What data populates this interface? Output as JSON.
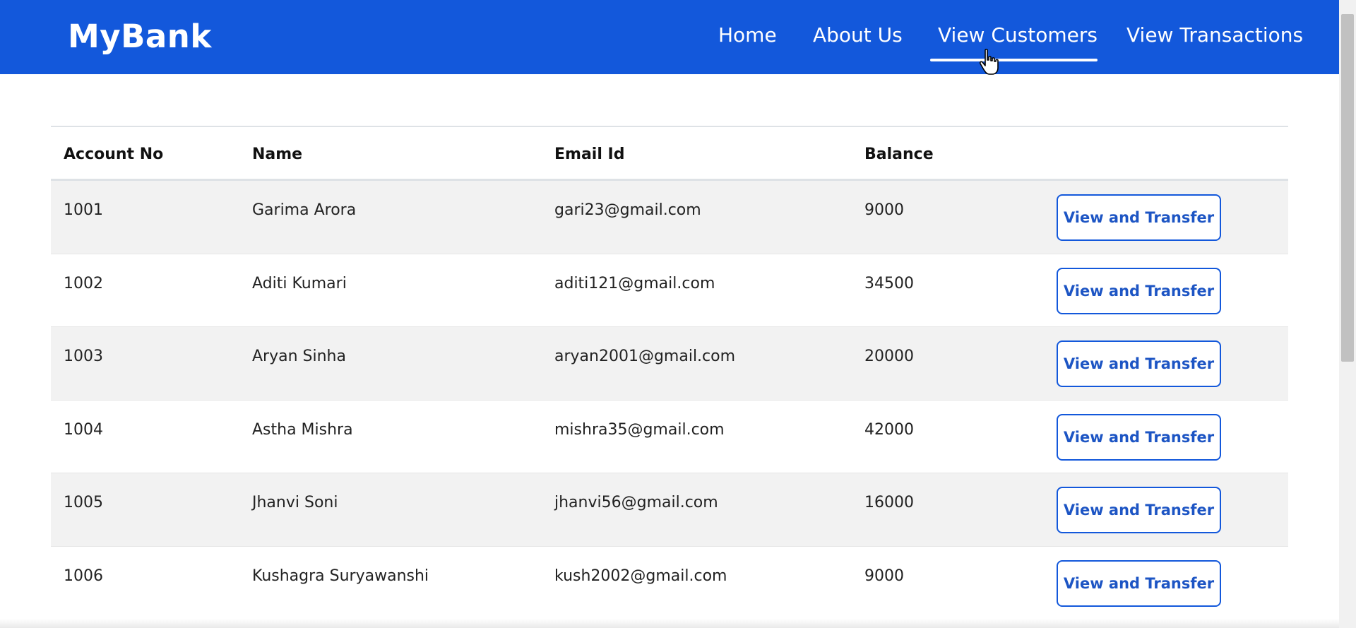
{
  "brand": "MyBank",
  "nav": {
    "home": "Home",
    "about": "About Us",
    "customers": "View Customers",
    "transactions": "View Transactions",
    "active": "View Customers"
  },
  "colors": {
    "navbar": "#1358db",
    "button_text": "#1d55c4",
    "row_stripe": "#f2f2f2"
  },
  "table": {
    "headers": [
      "Account No",
      "Name",
      "Email Id",
      "Balance"
    ],
    "button_label": "View and Transfer",
    "rows": [
      {
        "account": "1001",
        "name": "Garima Arora",
        "email": "gari23@gmail.com",
        "balance": "9000"
      },
      {
        "account": "1002",
        "name": "Aditi Kumari",
        "email": "aditi121@gmail.com",
        "balance": "34500"
      },
      {
        "account": "1003",
        "name": "Aryan Sinha",
        "email": "aryan2001@gmail.com",
        "balance": "20000"
      },
      {
        "account": "1004",
        "name": "Astha Mishra",
        "email": "mishra35@gmail.com",
        "balance": "42000"
      },
      {
        "account": "1005",
        "name": "Jhanvi Soni",
        "email": "jhanvi56@gmail.com",
        "balance": "16000"
      },
      {
        "account": "1006",
        "name": "Kushagra Suryawanshi",
        "email": "kush2002@gmail.com",
        "balance": "9000"
      }
    ]
  },
  "icons": {
    "cursor": "hand-pointer-icon"
  }
}
